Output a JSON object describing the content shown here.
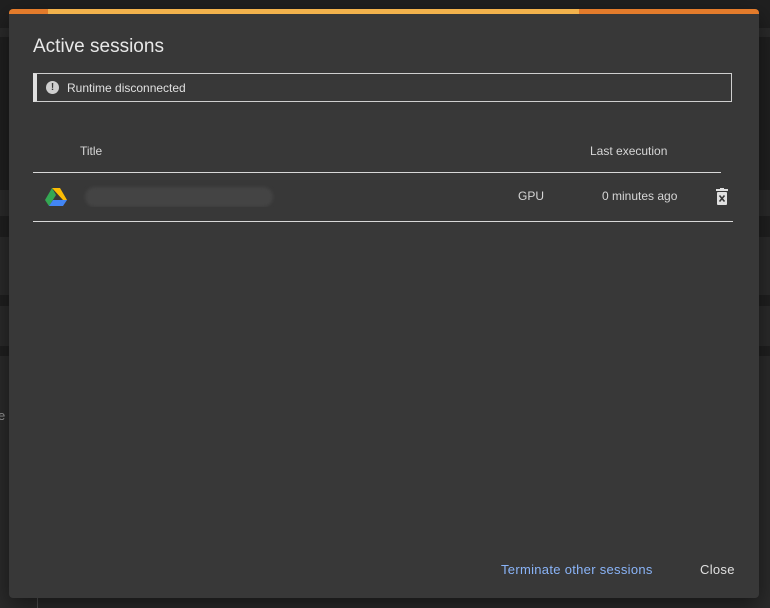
{
  "dialog": {
    "title": "Active sessions",
    "progress_fraction": 0.76,
    "alert": {
      "icon": "alert-circle-icon",
      "text": "Runtime disconnected"
    },
    "table": {
      "headers": {
        "title": "Title",
        "last_execution": "Last execution"
      },
      "rows": [
        {
          "icon": "google-drive-icon",
          "title": "",
          "accelerator": "GPU",
          "last_execution": "0 minutes ago",
          "action_icon": "delete-icon"
        }
      ]
    },
    "buttons": {
      "terminate_label": "Terminate other sessions",
      "close_label": "Close"
    }
  },
  "colors": {
    "dialog_bg": "#383838",
    "progress_track": "#e37b2b",
    "progress_fill": "#f2b24c",
    "link": "#8ab4f8"
  },
  "background": {
    "edge_glyph": "e"
  }
}
